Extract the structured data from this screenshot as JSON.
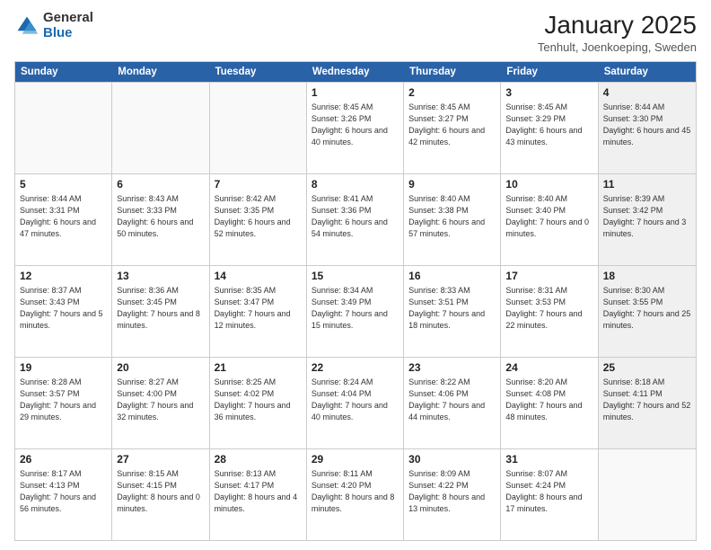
{
  "header": {
    "logo_general": "General",
    "logo_blue": "Blue",
    "title": "January 2025",
    "subtitle": "Tenhult, Joenkoeping, Sweden"
  },
  "calendar": {
    "days_of_week": [
      "Sunday",
      "Monday",
      "Tuesday",
      "Wednesday",
      "Thursday",
      "Friday",
      "Saturday"
    ],
    "weeks": [
      [
        {
          "day": "",
          "info": ""
        },
        {
          "day": "",
          "info": ""
        },
        {
          "day": "",
          "info": ""
        },
        {
          "day": "1",
          "info": "Sunrise: 8:45 AM\nSunset: 3:26 PM\nDaylight: 6 hours\nand 40 minutes."
        },
        {
          "day": "2",
          "info": "Sunrise: 8:45 AM\nSunset: 3:27 PM\nDaylight: 6 hours\nand 42 minutes."
        },
        {
          "day": "3",
          "info": "Sunrise: 8:45 AM\nSunset: 3:29 PM\nDaylight: 6 hours\nand 43 minutes."
        },
        {
          "day": "4",
          "info": "Sunrise: 8:44 AM\nSunset: 3:30 PM\nDaylight: 6 hours\nand 45 minutes."
        }
      ],
      [
        {
          "day": "5",
          "info": "Sunrise: 8:44 AM\nSunset: 3:31 PM\nDaylight: 6 hours\nand 47 minutes."
        },
        {
          "day": "6",
          "info": "Sunrise: 8:43 AM\nSunset: 3:33 PM\nDaylight: 6 hours\nand 50 minutes."
        },
        {
          "day": "7",
          "info": "Sunrise: 8:42 AM\nSunset: 3:35 PM\nDaylight: 6 hours\nand 52 minutes."
        },
        {
          "day": "8",
          "info": "Sunrise: 8:41 AM\nSunset: 3:36 PM\nDaylight: 6 hours\nand 54 minutes."
        },
        {
          "day": "9",
          "info": "Sunrise: 8:40 AM\nSunset: 3:38 PM\nDaylight: 6 hours\nand 57 minutes."
        },
        {
          "day": "10",
          "info": "Sunrise: 8:40 AM\nSunset: 3:40 PM\nDaylight: 7 hours\nand 0 minutes."
        },
        {
          "day": "11",
          "info": "Sunrise: 8:39 AM\nSunset: 3:42 PM\nDaylight: 7 hours\nand 3 minutes."
        }
      ],
      [
        {
          "day": "12",
          "info": "Sunrise: 8:37 AM\nSunset: 3:43 PM\nDaylight: 7 hours\nand 5 minutes."
        },
        {
          "day": "13",
          "info": "Sunrise: 8:36 AM\nSunset: 3:45 PM\nDaylight: 7 hours\nand 8 minutes."
        },
        {
          "day": "14",
          "info": "Sunrise: 8:35 AM\nSunset: 3:47 PM\nDaylight: 7 hours\nand 12 minutes."
        },
        {
          "day": "15",
          "info": "Sunrise: 8:34 AM\nSunset: 3:49 PM\nDaylight: 7 hours\nand 15 minutes."
        },
        {
          "day": "16",
          "info": "Sunrise: 8:33 AM\nSunset: 3:51 PM\nDaylight: 7 hours\nand 18 minutes."
        },
        {
          "day": "17",
          "info": "Sunrise: 8:31 AM\nSunset: 3:53 PM\nDaylight: 7 hours\nand 22 minutes."
        },
        {
          "day": "18",
          "info": "Sunrise: 8:30 AM\nSunset: 3:55 PM\nDaylight: 7 hours\nand 25 minutes."
        }
      ],
      [
        {
          "day": "19",
          "info": "Sunrise: 8:28 AM\nSunset: 3:57 PM\nDaylight: 7 hours\nand 29 minutes."
        },
        {
          "day": "20",
          "info": "Sunrise: 8:27 AM\nSunset: 4:00 PM\nDaylight: 7 hours\nand 32 minutes."
        },
        {
          "day": "21",
          "info": "Sunrise: 8:25 AM\nSunset: 4:02 PM\nDaylight: 7 hours\nand 36 minutes."
        },
        {
          "day": "22",
          "info": "Sunrise: 8:24 AM\nSunset: 4:04 PM\nDaylight: 7 hours\nand 40 minutes."
        },
        {
          "day": "23",
          "info": "Sunrise: 8:22 AM\nSunset: 4:06 PM\nDaylight: 7 hours\nand 44 minutes."
        },
        {
          "day": "24",
          "info": "Sunrise: 8:20 AM\nSunset: 4:08 PM\nDaylight: 7 hours\nand 48 minutes."
        },
        {
          "day": "25",
          "info": "Sunrise: 8:18 AM\nSunset: 4:11 PM\nDaylight: 7 hours\nand 52 minutes."
        }
      ],
      [
        {
          "day": "26",
          "info": "Sunrise: 8:17 AM\nSunset: 4:13 PM\nDaylight: 7 hours\nand 56 minutes."
        },
        {
          "day": "27",
          "info": "Sunrise: 8:15 AM\nSunset: 4:15 PM\nDaylight: 8 hours\nand 0 minutes."
        },
        {
          "day": "28",
          "info": "Sunrise: 8:13 AM\nSunset: 4:17 PM\nDaylight: 8 hours\nand 4 minutes."
        },
        {
          "day": "29",
          "info": "Sunrise: 8:11 AM\nSunset: 4:20 PM\nDaylight: 8 hours\nand 8 minutes."
        },
        {
          "day": "30",
          "info": "Sunrise: 8:09 AM\nSunset: 4:22 PM\nDaylight: 8 hours\nand 13 minutes."
        },
        {
          "day": "31",
          "info": "Sunrise: 8:07 AM\nSunset: 4:24 PM\nDaylight: 8 hours\nand 17 minutes."
        },
        {
          "day": "",
          "info": ""
        }
      ]
    ]
  }
}
